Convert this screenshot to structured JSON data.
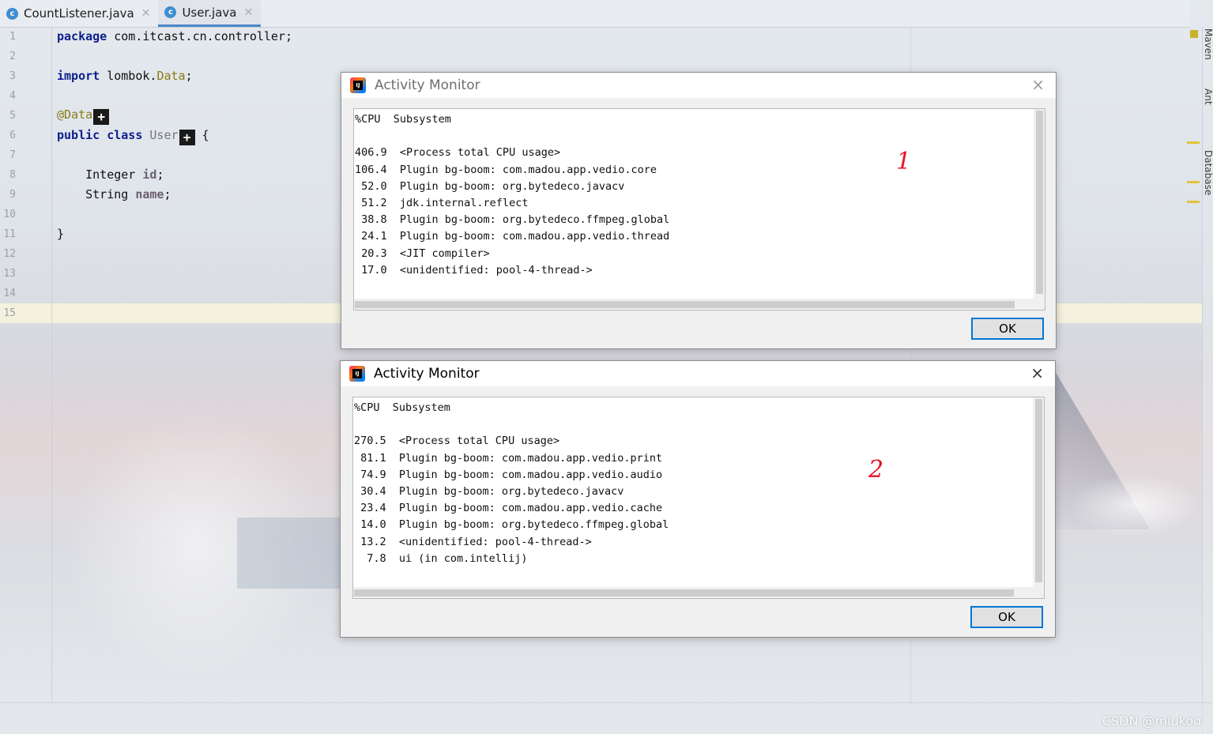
{
  "tabs": [
    {
      "label": "CountListener.java",
      "icon": "c"
    },
    {
      "label": "User.java",
      "icon": "c"
    }
  ],
  "line_numbers": [
    "1",
    "2",
    "3",
    "4",
    "5",
    "6",
    "7",
    "8",
    "9",
    "10",
    "11",
    "12",
    "13",
    "14",
    "15"
  ],
  "code": {
    "line1_kw": "package",
    "line1_rest": " com.itcast.cn.controller;",
    "line3_kw": "import",
    "line3_mid": " lombok.",
    "line3_ann": "Data",
    "line3_end": ";",
    "line5_ann": "@Data",
    "line6_kw": "public class",
    "line6_name": " User",
    "line6_end": " {",
    "line8_type": "    Integer ",
    "line8_field": "id",
    "line8_end": ";",
    "line9_type": "    String ",
    "line9_field": "name",
    "line9_end": ";",
    "line11": "}",
    "hint_glyph": "+"
  },
  "tool_windows": [
    "Maven",
    "Ant",
    "Database"
  ],
  "dialogs": [
    {
      "title": "Activity Monitor",
      "close": "×",
      "lines": [
        "%CPU  Subsystem",
        "",
        "406.9  <Process total CPU usage>",
        "106.4  Plugin bg-boom: com.madou.app.vedio.core",
        " 52.0  Plugin bg-boom: org.bytedeco.javacv",
        " 51.2  jdk.internal.reflect",
        " 38.8  Plugin bg-boom: org.bytedeco.ffmpeg.global",
        " 24.1  Plugin bg-boom: com.madou.app.vedio.thread",
        " 20.3  <JIT compiler>",
        " 17.0  <unidentified: pool-4-thread->"
      ],
      "ok_label": "OK",
      "scribble": "1"
    },
    {
      "title": "Activity Monitor",
      "close": "×",
      "lines": [
        "%CPU  Subsystem",
        "",
        "270.5  <Process total CPU usage>",
        " 81.1  Plugin bg-boom: com.madou.app.vedio.print",
        " 74.9  Plugin bg-boom: com.madou.app.vedio.audio",
        " 30.4  Plugin bg-boom: org.bytedeco.javacv",
        " 23.4  Plugin bg-boom: com.madou.app.vedio.cache",
        " 14.0  Plugin bg-boom: org.bytedeco.ffmpeg.global",
        " 13.2  <unidentified: pool-4-thread->",
        "  7.8  ui (in com.intellij)"
      ],
      "ok_label": "OK",
      "scribble": "2"
    }
  ],
  "watermark": "CSDN @miukoo"
}
